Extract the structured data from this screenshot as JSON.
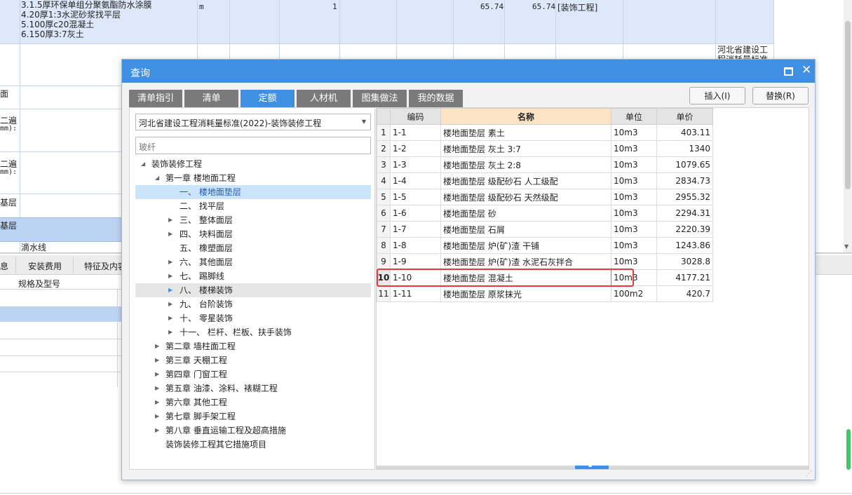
{
  "background": {
    "top_row": {
      "desc_lines": [
        "3.1.5厚环保单组分聚氨酯防水涂膜",
        "4.20厚1:3水泥砂浆找平层",
        "5.100厚c20混凝土",
        "6.150厚3:7灰土"
      ],
      "unit": "m",
      "qty": "1",
      "price1": "65.74",
      "price2": "65.74",
      "category": "[装饰工程]"
    },
    "right_note": "河北省建设工程消耗量标准",
    "left_fragments": [
      "面",
      "二遍",
      "mm):",
      "二遍",
      "mm):",
      "基层",
      "基层",
      "滴水线"
    ],
    "bottom_tabs": [
      "息",
      "安装费用",
      "特征及内容"
    ],
    "bottom_header": "规格及型号"
  },
  "dialog": {
    "title": "查询",
    "tabs": [
      "清单指引",
      "清单",
      "定额",
      "人材机",
      "图集做法",
      "我的数据"
    ],
    "active_tab": "定额",
    "insert_button": "插入(I)",
    "replace_button": "替换(R)",
    "standard_select": "河北省建设工程消耗量标准(2022)-装饰装修工程",
    "search_placeholder": "玻纤",
    "tree": [
      {
        "label": "装饰装修工程",
        "level": 0,
        "expanded": true
      },
      {
        "label": "第一章 楼地面工程",
        "level": 1,
        "expanded": true
      },
      {
        "label": "一、 楼地面垫层",
        "level": 2,
        "selected": true
      },
      {
        "label": "二、 找平层",
        "level": 2
      },
      {
        "label": "三、 整体面层",
        "level": 2,
        "collapsed": true
      },
      {
        "label": "四、 块料面层",
        "level": 2,
        "collapsed": true
      },
      {
        "label": "五、 橡塑面层",
        "level": 2
      },
      {
        "label": "六、 其他面层",
        "level": 2,
        "collapsed": true
      },
      {
        "label": "七、 踢脚线",
        "level": 2,
        "collapsed": true
      },
      {
        "label": "八、 楼梯装饰",
        "level": 2,
        "collapsed": true,
        "hover": true
      },
      {
        "label": "九、 台阶装饰",
        "level": 2,
        "collapsed": true
      },
      {
        "label": "十、 零星装饰",
        "level": 2,
        "collapsed": true
      },
      {
        "label": "十一、 栏杆、栏板、扶手装饰",
        "level": 2,
        "collapsed": true
      },
      {
        "label": "第二章 墙柱面工程",
        "level": 1,
        "collapsed": true
      },
      {
        "label": "第三章 天棚工程",
        "level": 1,
        "collapsed": true
      },
      {
        "label": "第四章 门窗工程",
        "level": 1,
        "collapsed": true
      },
      {
        "label": "第五章 油漆、涂料、裱糊工程",
        "level": 1,
        "collapsed": true
      },
      {
        "label": "第六章 其他工程",
        "level": 1,
        "collapsed": true
      },
      {
        "label": "第七章 脚手架工程",
        "level": 1,
        "collapsed": true
      },
      {
        "label": "第八章 垂直运输工程及超高措施",
        "level": 1,
        "collapsed": true
      },
      {
        "label": "装饰装修工程其它措施项目",
        "level": 1
      }
    ],
    "table": {
      "headers": [
        "编码",
        "名称",
        "单位",
        "单价"
      ],
      "rows": [
        {
          "n": "1",
          "code": "1-1",
          "name": "楼地面垫层 素土",
          "unit": "10m3",
          "price": "403.11"
        },
        {
          "n": "2",
          "code": "1-2",
          "name": "楼地面垫层 灰土 3:7",
          "unit": "10m3",
          "price": "1340"
        },
        {
          "n": "3",
          "code": "1-3",
          "name": "楼地面垫层 灰土 2:8",
          "unit": "10m3",
          "price": "1079.65"
        },
        {
          "n": "4",
          "code": "1-4",
          "name": "楼地面垫层 级配砂石 人工级配",
          "unit": "10m3",
          "price": "2834.73"
        },
        {
          "n": "5",
          "code": "1-5",
          "name": "楼地面垫层 级配砂石 天然级配",
          "unit": "10m3",
          "price": "2955.32"
        },
        {
          "n": "6",
          "code": "1-6",
          "name": "楼地面垫层 砂",
          "unit": "10m3",
          "price": "2294.31"
        },
        {
          "n": "7",
          "code": "1-7",
          "name": "楼地面垫层 石屑",
          "unit": "10m3",
          "price": "2220.39"
        },
        {
          "n": "8",
          "code": "1-8",
          "name": "楼地面垫层 炉(矿)渣 干铺",
          "unit": "10m3",
          "price": "1243.86"
        },
        {
          "n": "9",
          "code": "1-9",
          "name": "楼地面垫层 炉(矿)渣 水泥石灰拌合",
          "unit": "10m3",
          "price": "3028.8"
        },
        {
          "n": "10",
          "code": "1-10",
          "name": "楼地面垫层 混凝土",
          "unit": "10m3",
          "price": "4177.21",
          "selected": true
        },
        {
          "n": "11",
          "code": "1-11",
          "name": "楼地面垫层 原浆抹光",
          "unit": "100m2",
          "price": "420.7"
        }
      ]
    }
  }
}
